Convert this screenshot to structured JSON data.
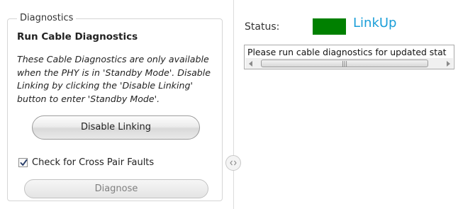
{
  "left_panel": {
    "group_title": "Diagnostics",
    "section_title": "Run Cable Diagnostics",
    "description": "These Cable Diagnostics are only available when the PHY is in 'Standby Mode'. Disable Linking by clicking the 'Disable Linking' button to enter 'Standby Mode'.",
    "disable_linking_label": "Disable Linking",
    "cross_pair_label": "Check for Cross Pair Faults",
    "cross_pair_checked": true,
    "diagnose_label": "Diagnose",
    "diagnose_enabled": false
  },
  "right_panel": {
    "status_label": "Status:",
    "status_value": "LinkUp",
    "status_color": "#008000",
    "status_text_color": "#1a9ed8",
    "message": "Please run cable diagnostics for updated stat"
  },
  "icons": {
    "checkbox_check": "check-mark-icon",
    "splitter_handle": "collapse-arrows-icon",
    "scroll_left": "arrow-left-icon",
    "scroll_right": "arrow-right-icon",
    "thumb_grip": "grip-icon"
  }
}
